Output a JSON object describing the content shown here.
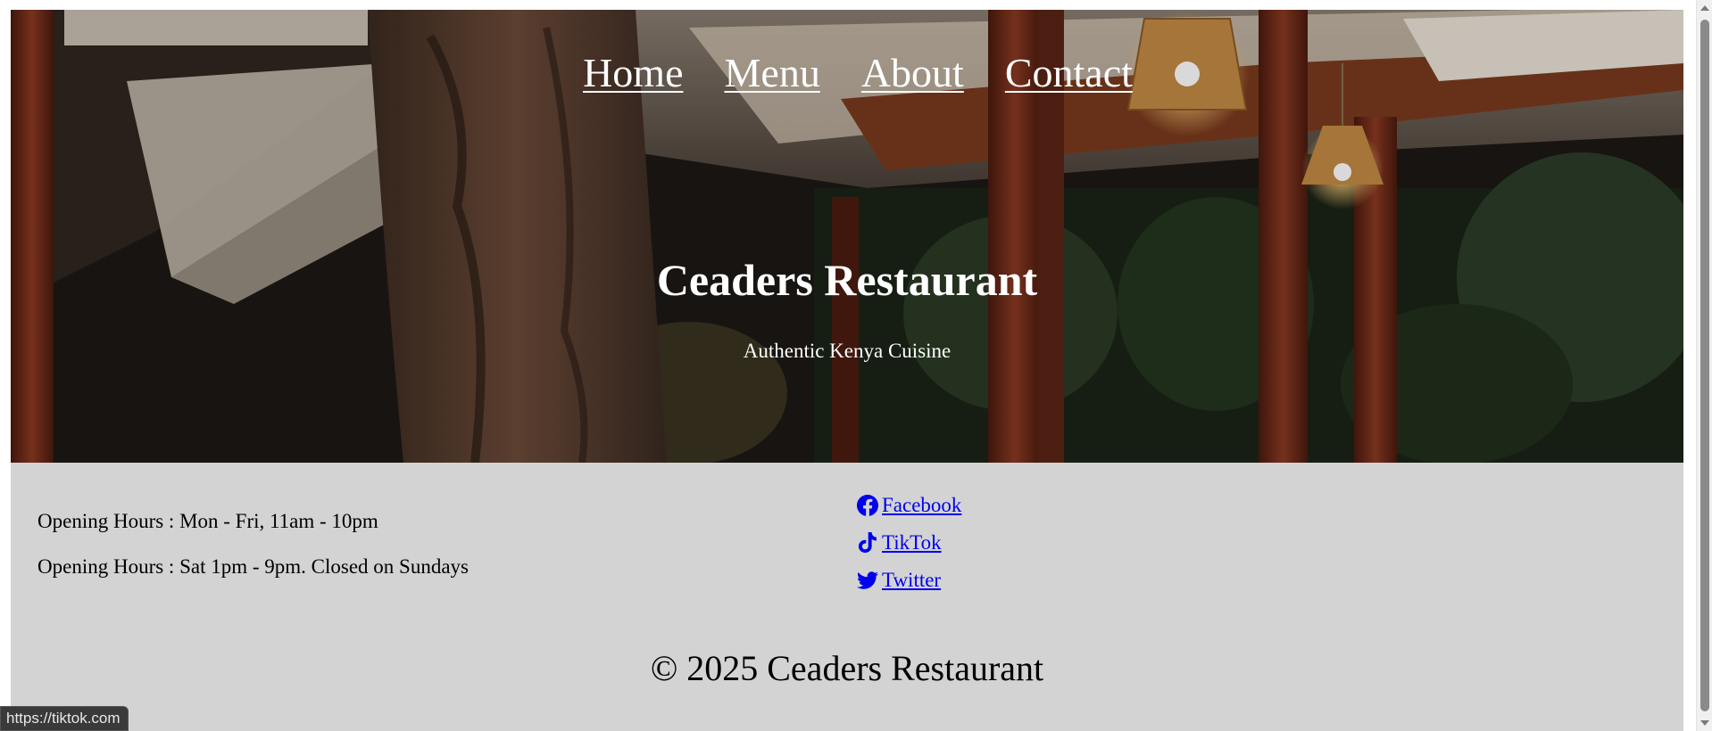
{
  "nav": {
    "items": [
      "Home",
      "Menu",
      "About",
      "Contact"
    ]
  },
  "hero": {
    "title": "Ceaders Restaurant",
    "subtitle": "Authentic Kenya Cuisine"
  },
  "hours": {
    "weekday": "Opening Hours : Mon - Fri, 11am - 10pm",
    "weekend": "Opening Hours : Sat 1pm - 9pm. Closed on Sundays"
  },
  "social": {
    "facebook": "Facebook",
    "tiktok": "TikTok",
    "twitter": "Twitter"
  },
  "footer": {
    "copyright": "© 2025 Ceaders Restaurant"
  },
  "status_bar": {
    "url": "https://tiktok.com"
  },
  "colors": {
    "link": "#0000ee",
    "footer_bg": "#d3d3d3",
    "hero_text": "#ffffff"
  }
}
